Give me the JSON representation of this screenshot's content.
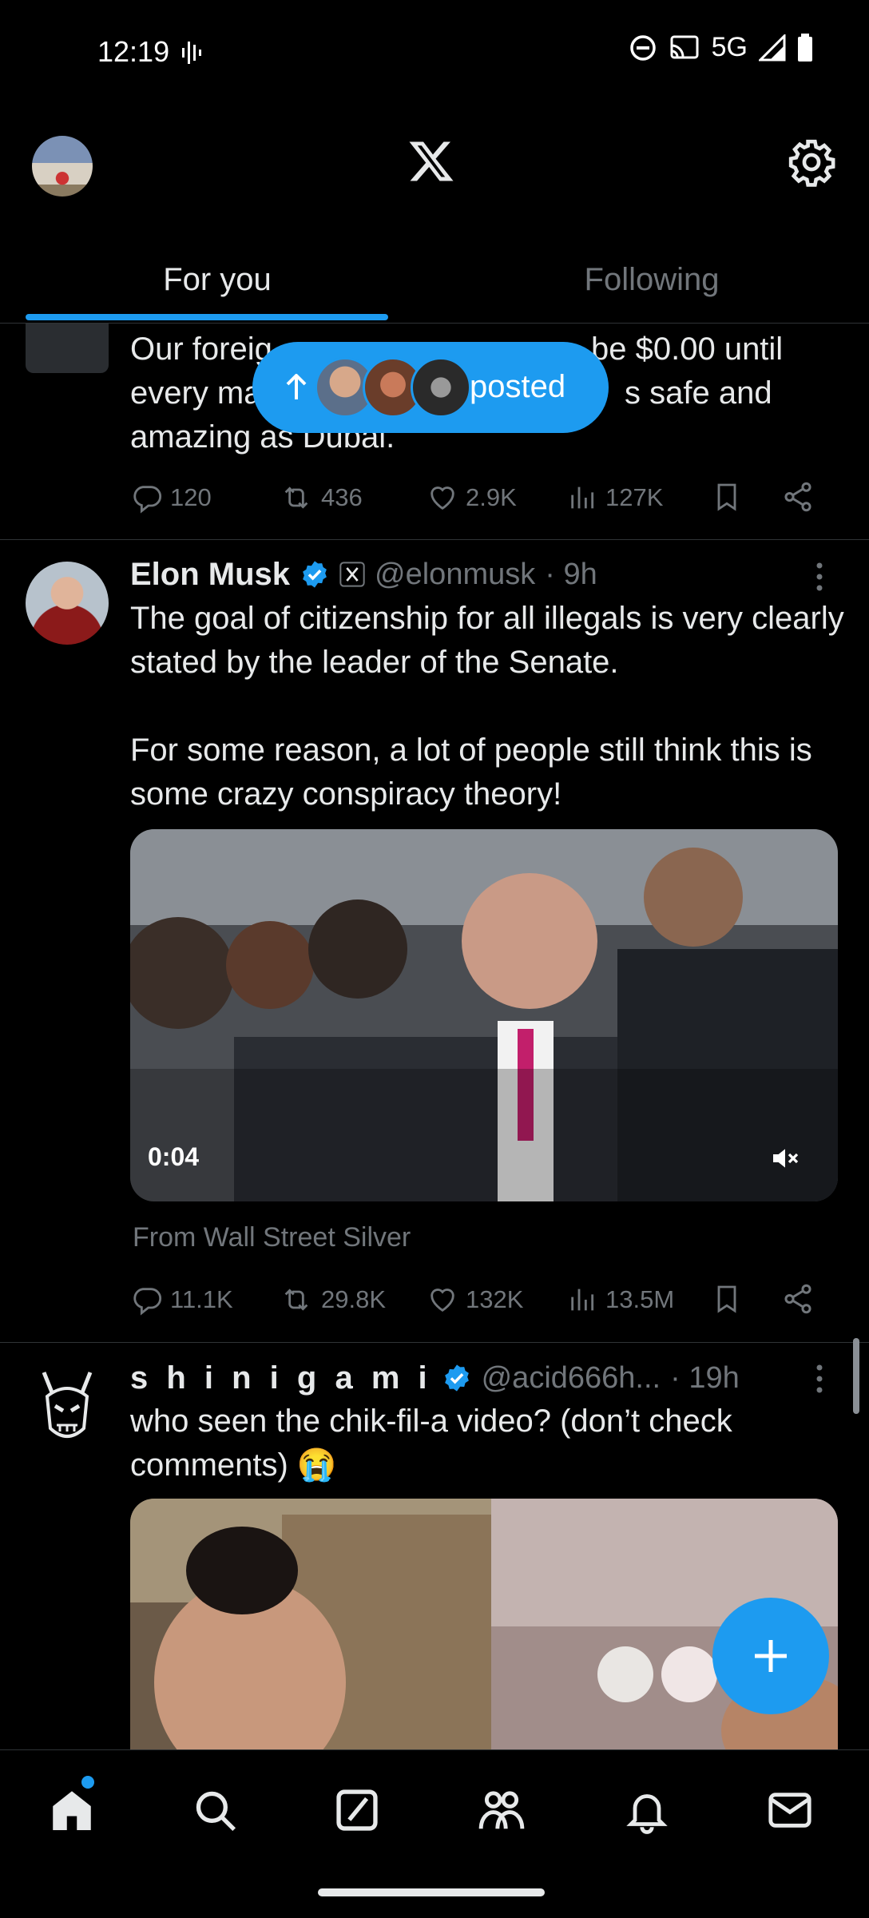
{
  "status_bar": {
    "time": "12:19",
    "network": "5G"
  },
  "header": {
    "tabs": [
      {
        "label": "For you"
      },
      {
        "label": "Following"
      }
    ]
  },
  "posted_pill": {
    "label": "posted"
  },
  "tweet1": {
    "text_line1": "Our foreig",
    "text_line1b": "be $0.00 until",
    "text_line2": "every ma",
    "text_line2b": "s safe and",
    "text_line3": "amazing as Dubai.",
    "replies": "120",
    "reposts": "436",
    "likes": "2.9K",
    "views": "127K"
  },
  "tweet2": {
    "author": "Elon Musk",
    "handle": "@elonmusk",
    "time": "· 9h",
    "text": "The goal of citizenship for all illegals is very clearly stated by the leader of the Senate.\n\nFor some reason, a lot of people still think this is some crazy conspiracy theory!",
    "video_time": "0:04",
    "source": "From Wall Street Silver",
    "replies": "11.1K",
    "reposts": "29.8K",
    "likes": "132K",
    "views": "13.5M"
  },
  "tweet3": {
    "author": "s h i n i g a m i",
    "handle": "@acid666h...",
    "time": "· 19h",
    "text": "who seen the chik-fil-a video? (don’t check comments) 😭"
  },
  "colors": {
    "accent": "#1d9bf0",
    "muted": "#71767b",
    "text": "#e7e9ea",
    "background": "#000000"
  }
}
